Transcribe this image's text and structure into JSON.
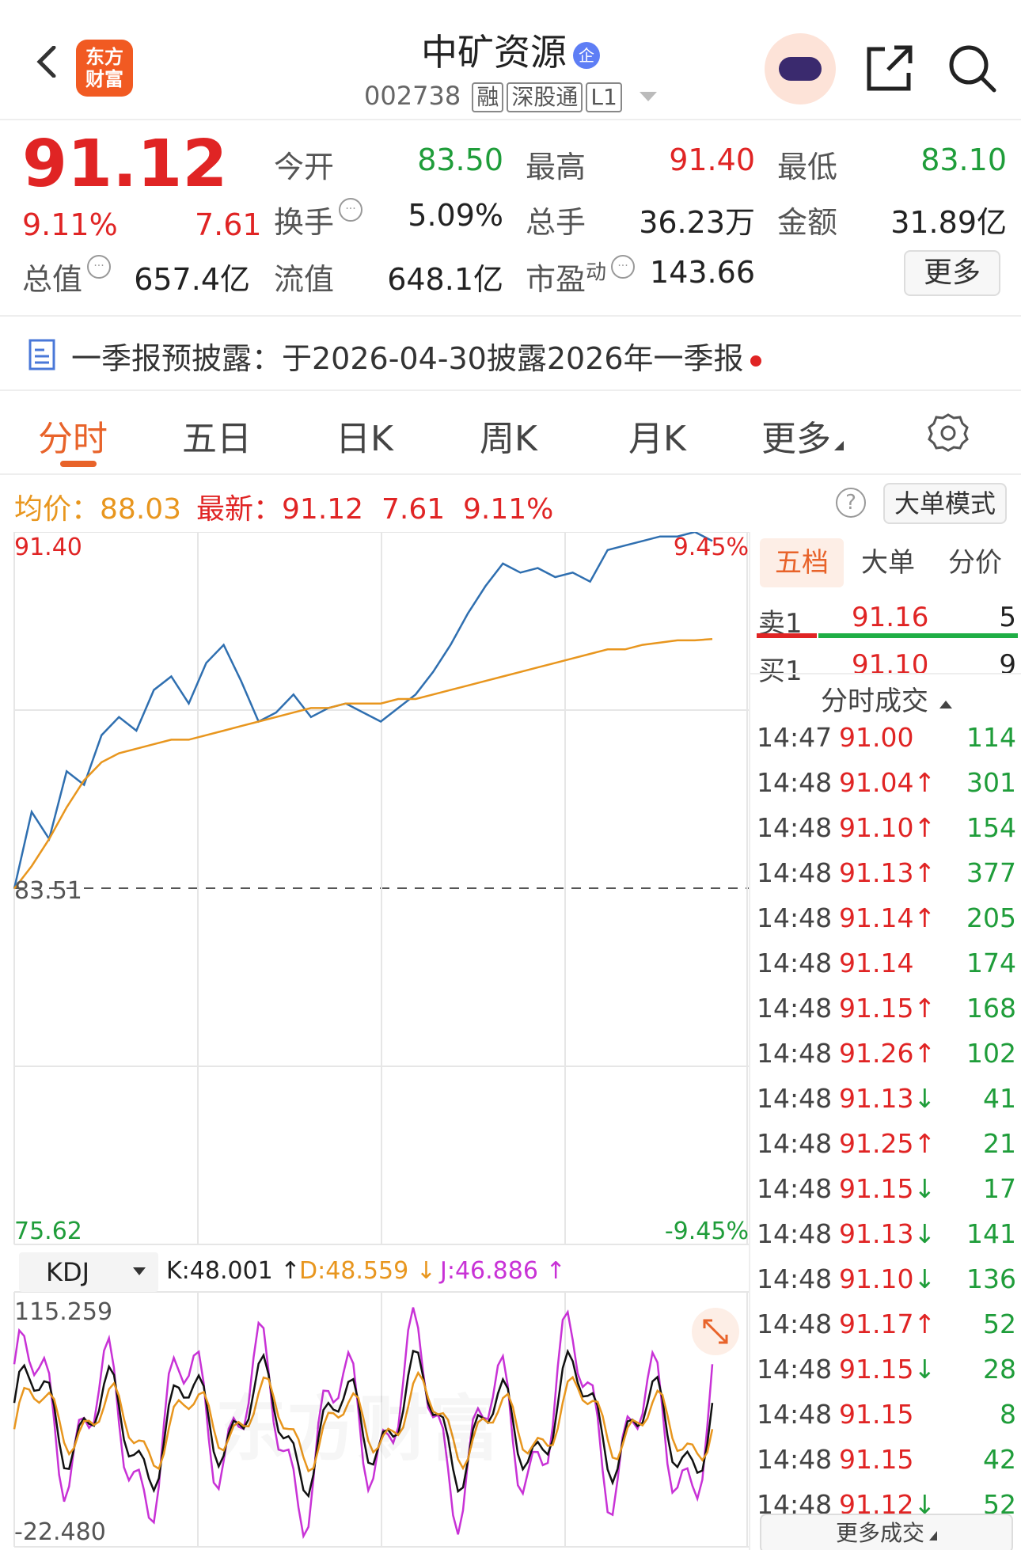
{
  "header": {
    "logo_top": "东方",
    "logo_bottom": "财富",
    "title": "中矿资源",
    "title_badge": "企",
    "code": "002738",
    "tags": [
      "融",
      "深股通",
      "L1"
    ]
  },
  "quote": {
    "price": "91.12",
    "pct": "9.11%",
    "change": "7.61",
    "open_label": "今开",
    "open": "83.50",
    "high_label": "最高",
    "high": "91.40",
    "low_label": "最低",
    "low": "83.10",
    "turnover_label": "换手",
    "turnover": "5.09%",
    "volume_label": "总手",
    "volume": "36.23万",
    "amount_label": "金额",
    "amount": "31.89亿",
    "mcap_label": "总值",
    "mcap": "657.4亿",
    "float_label": "流值",
    "float": "648.1亿",
    "pe_label": "市盈",
    "pe_sup": "动",
    "pe": "143.66",
    "more_label": "更多"
  },
  "notice": {
    "text": "一季报预披露：于2026-04-30披露2026年一季报"
  },
  "tabs": [
    "分时",
    "五日",
    "日K",
    "周K",
    "月K",
    "更多"
  ],
  "legend": {
    "avg_label": "均价：",
    "avg": "88.03",
    "latest_label": "最新：",
    "latest": "91.12",
    "change": "7.61",
    "pct": "9.11%",
    "big_mode": "大单模式"
  },
  "chart_labels": {
    "top_price": "91.40",
    "top_pct": "9.45%",
    "mid_price": "83.51",
    "bottom_price": "75.62",
    "bottom_pct": "-9.45%",
    "watermark": "东方财富",
    "indicator": "KDJ",
    "k": "K:48.001 ↑",
    "d": "D:48.559 ↓",
    "j": "J:46.886 ↑",
    "kdj_max": "115.259",
    "kdj_min": "-22.480"
  },
  "colors": {
    "up": "#e02424",
    "down": "#1f9d3a",
    "price_line": "#2f6fb0",
    "avg_line": "#e8961e",
    "k_line": "#111111",
    "d_line": "#e8961e",
    "j_line": "#c832d6",
    "accent": "#e8632a"
  },
  "chart_data": {
    "type": "line",
    "ylim": [
      75.62,
      91.4
    ],
    "series": [
      {
        "name": "价格",
        "values": [
          83.5,
          85.2,
          84.6,
          86.1,
          85.8,
          86.9,
          87.3,
          87.0,
          87.9,
          88.2,
          87.6,
          88.5,
          88.9,
          88.1,
          87.2,
          87.4,
          87.8,
          87.3,
          87.5,
          87.6,
          87.4,
          87.2,
          87.5,
          87.8,
          88.3,
          88.9,
          89.6,
          90.2,
          90.7,
          90.5,
          90.6,
          90.4,
          90.5,
          90.3,
          91.0,
          91.1,
          91.2,
          91.3,
          91.3,
          91.4,
          91.2
        ]
      },
      {
        "name": "均价",
        "values": [
          83.5,
          84.0,
          84.6,
          85.3,
          85.9,
          86.3,
          86.5,
          86.6,
          86.7,
          86.8,
          86.8,
          86.9,
          87.0,
          87.1,
          87.2,
          87.3,
          87.4,
          87.5,
          87.5,
          87.6,
          87.6,
          87.6,
          87.7,
          87.7,
          87.8,
          87.9,
          88.0,
          88.1,
          88.2,
          88.3,
          88.4,
          88.5,
          88.6,
          88.7,
          88.8,
          88.8,
          88.9,
          88.95,
          89.0,
          89.0,
          89.03
        ]
      }
    ]
  },
  "order_book": {
    "tabs": [
      "五档",
      "大单",
      "分价"
    ],
    "sell1_label": "卖1",
    "sell1_price": "91.16",
    "sell1_vol": "5",
    "buy1_label": "买1",
    "buy1_price": "91.10",
    "buy1_vol": "9",
    "trades_header": "分时成交",
    "more_trades": "更多成交",
    "trades": [
      {
        "time": "14:47",
        "price": "91.00",
        "arrow": "",
        "vol": "114"
      },
      {
        "time": "14:48",
        "price": "91.04",
        "arrow": "↑",
        "vol": "301"
      },
      {
        "time": "14:48",
        "price": "91.10",
        "arrow": "↑",
        "vol": "154"
      },
      {
        "time": "14:48",
        "price": "91.13",
        "arrow": "↑",
        "vol": "377"
      },
      {
        "time": "14:48",
        "price": "91.14",
        "arrow": "↑",
        "vol": "205"
      },
      {
        "time": "14:48",
        "price": "91.14",
        "arrow": "",
        "vol": "174"
      },
      {
        "time": "14:48",
        "price": "91.15",
        "arrow": "↑",
        "vol": "168"
      },
      {
        "time": "14:48",
        "price": "91.26",
        "arrow": "↑",
        "vol": "102"
      },
      {
        "time": "14:48",
        "price": "91.13",
        "arrow": "↓",
        "vol": "41"
      },
      {
        "time": "14:48",
        "price": "91.25",
        "arrow": "↑",
        "vol": "21"
      },
      {
        "time": "14:48",
        "price": "91.15",
        "arrow": "↓",
        "vol": "17"
      },
      {
        "time": "14:48",
        "price": "91.13",
        "arrow": "↓",
        "vol": "141"
      },
      {
        "time": "14:48",
        "price": "91.10",
        "arrow": "↓",
        "vol": "136"
      },
      {
        "time": "14:48",
        "price": "91.17",
        "arrow": "↑",
        "vol": "52"
      },
      {
        "time": "14:48",
        "price": "91.15",
        "arrow": "↓",
        "vol": "28"
      },
      {
        "time": "14:48",
        "price": "91.15",
        "arrow": "",
        "vol": "8"
      },
      {
        "time": "14:48",
        "price": "91.15",
        "arrow": "",
        "vol": "42"
      },
      {
        "time": "14:48",
        "price": "91.12",
        "arrow": "↓",
        "vol": "52"
      }
    ]
  }
}
